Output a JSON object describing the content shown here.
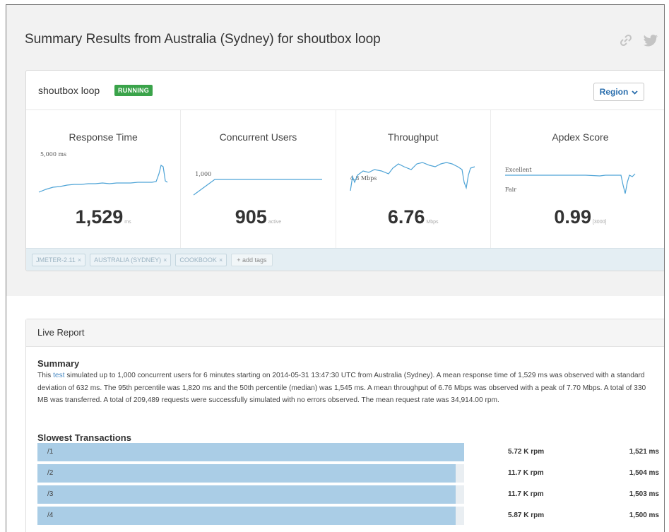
{
  "header": {
    "title": "Summary Results from Australia (Sydney) for shoutbox loop",
    "link_icon": "link-icon",
    "twitter_icon": "twitter-icon"
  },
  "test": {
    "name": "shoutbox loop",
    "status": "RUNNING",
    "status_color": "#3aa34a",
    "region_label": "Region"
  },
  "metrics": [
    {
      "title": "Response Time",
      "spark_label": "5,000 ms",
      "value": "1,529",
      "unit": "ms"
    },
    {
      "title": "Concurrent Users",
      "spark_label": "1,000",
      "value": "905",
      "unit": "active"
    },
    {
      "title": "Throughput",
      "spark_label": "4.8 Mbps",
      "value": "6.76",
      "unit": "Mbps"
    },
    {
      "title": "Apdex Score",
      "spark_label_top": "Excellent",
      "spark_label_bottom": "Fair",
      "value": "0.99",
      "unit": "[3000]"
    }
  ],
  "tags": [
    "JMETER-2.11",
    "AUSTRALIA (SYDNEY)",
    "COOKBOOK"
  ],
  "add_tags_label": "+ add tags",
  "report": {
    "title": "Live Report",
    "summary_heading": "Summary",
    "summary_prefix": "This ",
    "summary_link": "test",
    "summary_body": " simulated up to 1,000 concurrent users for 6 minutes starting on 2014-05-31 13:47:30 UTC from Australia (Sydney). A mean response time of 1,529 ms was observed with a standard deviation of 632 ms. The 95th percentile was 1,820 ms and the 50th percentile (median) was 1,545 ms. A mean throughput of 6.76 Mbps was observed with a peak of 7.70 Mbps. A total of 330 MB was transferred. A total of 209,489 requests were successfully simulated with no errors observed. The mean request rate was 34,914.00 rpm.",
    "slowest_heading": "Slowest Transactions",
    "transactions": [
      {
        "name": "/1",
        "rpm": "5.72 K rpm",
        "ms": "1,521 ms",
        "share": 1.0
      },
      {
        "name": "/2",
        "rpm": "11.7 K rpm",
        "ms": "1,504 ms",
        "share": 0.98
      },
      {
        "name": "/3",
        "rpm": "11.7 K rpm",
        "ms": "1,503 ms",
        "share": 0.98
      },
      {
        "name": "/4",
        "rpm": "5.87 K rpm",
        "ms": "1,500 ms",
        "share": 0.98
      }
    ]
  }
}
